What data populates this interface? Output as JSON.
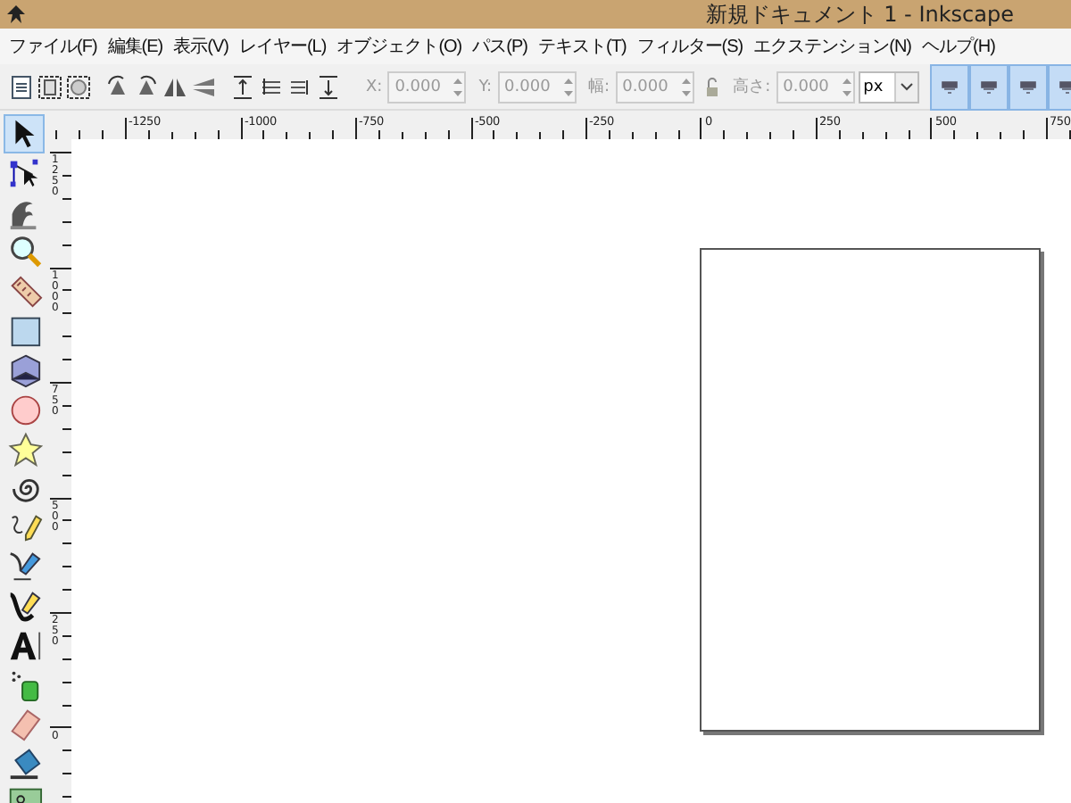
{
  "window": {
    "title": "新規ドキュメント 1 - Inkscape"
  },
  "menu": [
    "ファイル(F)",
    "編集(E)",
    "表示(V)",
    "レイヤー(L)",
    "オブジェクト(O)",
    "パス(P)",
    "テキスト(T)",
    "フィルター(S)",
    "エクステンション(N)",
    "ヘルプ(H)"
  ],
  "toolbar": {
    "fields": [
      {
        "label": "X:",
        "value": "0.000",
        "disabled": true
      },
      {
        "label": "Y:",
        "value": "0.000",
        "disabled": true
      },
      {
        "label": "幅:",
        "value": "0.000",
        "disabled": true
      },
      {
        "label": "高さ:",
        "value": "0.000",
        "disabled": true
      }
    ],
    "unit": "px",
    "toggles": [
      {
        "on": true
      },
      {
        "on": true
      },
      {
        "on": true
      },
      {
        "on": true
      }
    ]
  },
  "tools": [
    {
      "kind": "selector",
      "selected": true
    },
    {
      "kind": "node",
      "selected": false
    },
    {
      "kind": "tweak",
      "selected": false
    },
    {
      "kind": "zoom",
      "selected": false
    },
    {
      "kind": "measure",
      "selected": false
    },
    {
      "kind": "rect",
      "selected": false
    },
    {
      "kind": "box3d",
      "selected": false
    },
    {
      "kind": "ellipse",
      "selected": false
    },
    {
      "kind": "star",
      "selected": false
    },
    {
      "kind": "spiral",
      "selected": false
    },
    {
      "kind": "pencil",
      "selected": false
    },
    {
      "kind": "pen",
      "selected": false
    },
    {
      "kind": "calligraphy",
      "selected": false
    },
    {
      "kind": "text",
      "selected": false
    },
    {
      "kind": "spray",
      "selected": false
    },
    {
      "kind": "eraser",
      "selected": false
    },
    {
      "kind": "bucket",
      "selected": false
    },
    {
      "kind": "gradient",
      "selected": false
    }
  ],
  "rulers": {
    "horizontal": [
      "-1250",
      "-1000",
      "-750",
      "-500",
      "-250",
      "0",
      "250",
      "500",
      "750"
    ],
    "vertical": [
      "1250",
      "1000",
      "750",
      "500",
      "250",
      "0"
    ]
  }
}
